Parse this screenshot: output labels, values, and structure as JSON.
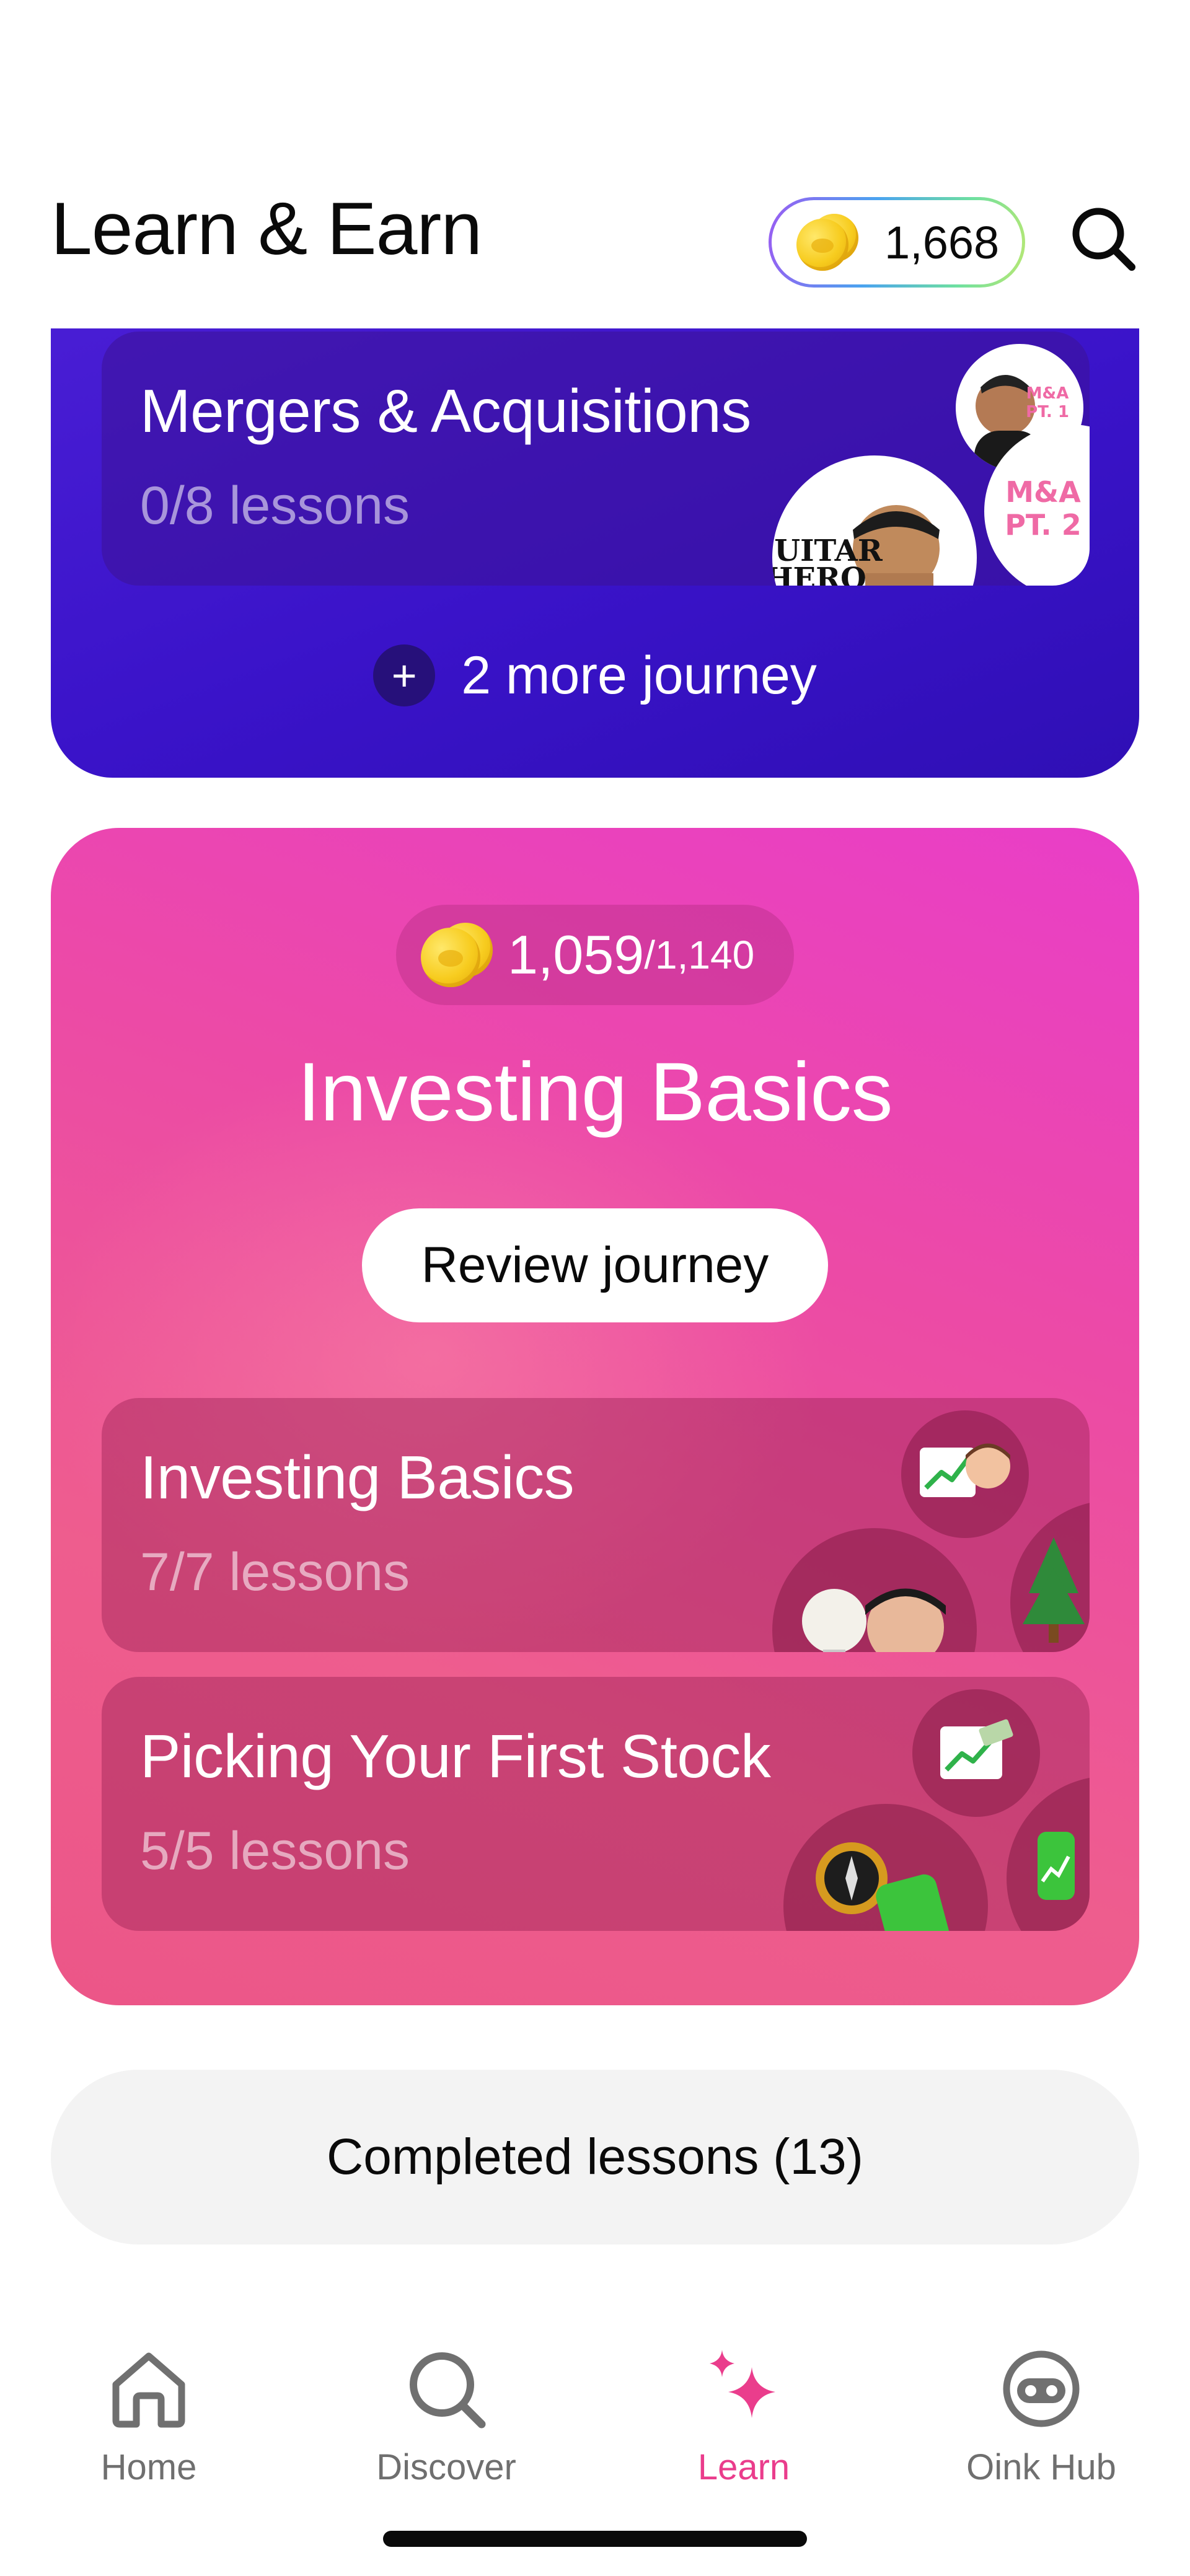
{
  "header": {
    "title": "Learn & Earn",
    "coin_balance": "1,668",
    "icons": {
      "coin": "coin-icon",
      "search": "search-icon"
    }
  },
  "journey_group_1": {
    "journeys": [
      {
        "title": "Mergers & Acquisitions",
        "progress": "0/8 lessons",
        "thumb_labels": [
          "M&A PT. 1",
          "M&A PT. 2",
          "GUITAR HERO"
        ]
      }
    ],
    "more_label": "2 more journey"
  },
  "journey_group_2": {
    "earned": "1,059",
    "total": "/1,140",
    "title": "Investing Basics",
    "review_button": "Review journey",
    "journeys": [
      {
        "title": "Investing Basics",
        "progress": "7/7 lessons"
      },
      {
        "title": "Picking Your First Stock",
        "progress": "5/5 lessons"
      }
    ]
  },
  "completed_button": "Completed lessons (13)",
  "bottom_nav": [
    {
      "label": "Home",
      "icon": "home-icon",
      "active": false
    },
    {
      "label": "Discover",
      "icon": "search-icon",
      "active": false
    },
    {
      "label": "Learn",
      "icon": "sparkles-icon",
      "active": true
    },
    {
      "label": "Oink Hub",
      "icon": "pig-face-icon",
      "active": false
    }
  ],
  "colors": {
    "accent_pink": "#ea3d8c",
    "purple_card": "#3a13c9",
    "pink_card": "#ec4aa6"
  }
}
